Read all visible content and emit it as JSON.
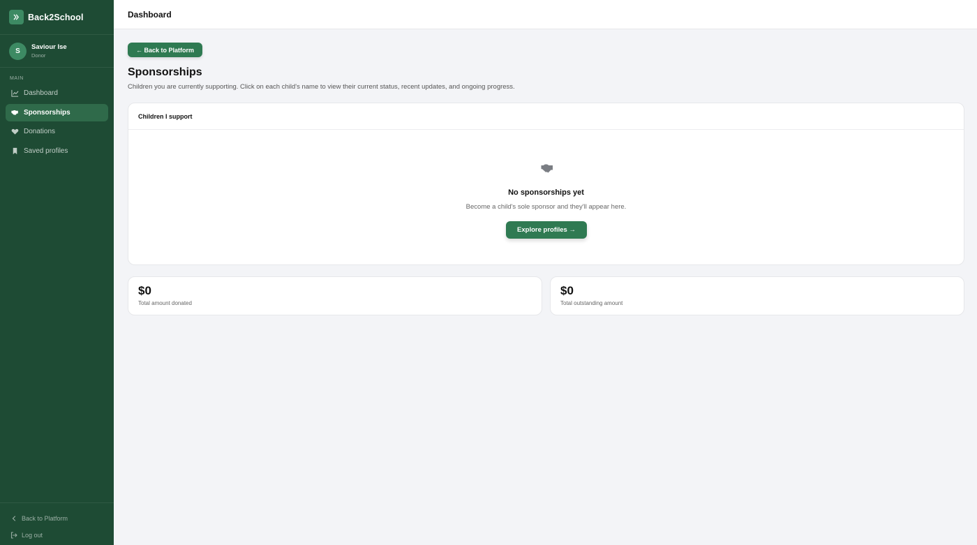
{
  "sidebar": {
    "brand": "Back2School",
    "user": {
      "initial": "S",
      "name": "Saviour Ise",
      "role": "Donor"
    },
    "section_label": "MAIN",
    "items": [
      {
        "label": "Dashboard",
        "icon": "chart-line-icon"
      },
      {
        "label": "Sponsorships",
        "icon": "handshake-icon",
        "active": true
      },
      {
        "label": "Donations",
        "icon": "heart-icon"
      },
      {
        "label": "Saved profiles",
        "icon": "bookmark-icon"
      }
    ],
    "footer": {
      "back_label": "Back to Platform",
      "logout_label": "Log out"
    }
  },
  "topbar": {
    "title": "Dashboard"
  },
  "main": {
    "back_button": "← Back to Platform",
    "title": "Sponsorships",
    "subtitle": "Children you are currently supporting. Click on each child's name to view their current status, recent updates, and ongoing progress.",
    "support_card": {
      "header": "Children I support",
      "empty_title": "No sponsorships yet",
      "empty_text": "Become a child's sole sponsor and they'll appear here.",
      "explore_button": "Explore profiles →"
    },
    "stats": [
      {
        "value": "$0",
        "label": "Total amount donated"
      },
      {
        "value": "$0",
        "label": "Total outstanding amount"
      }
    ]
  },
  "colors": {
    "sidebar_bg": "#1e4b34",
    "accent": "#2f7a52",
    "active_item": "#2f6a4a"
  }
}
